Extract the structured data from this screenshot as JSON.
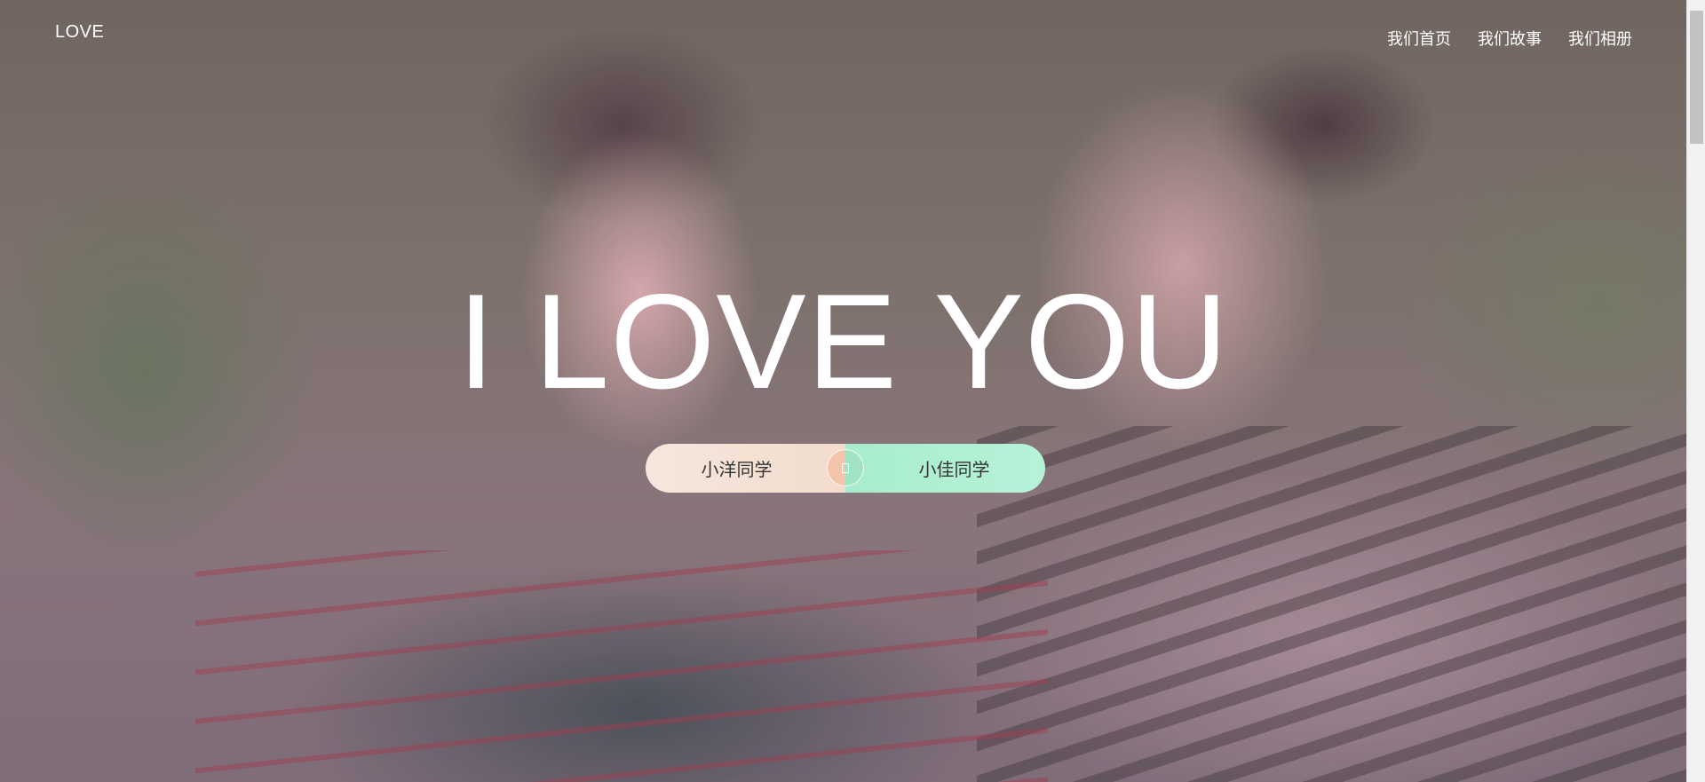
{
  "header": {
    "logo": "LOVE",
    "nav": [
      "我们首页",
      "我们故事",
      "我们相册"
    ]
  },
  "hero": {
    "headline": "I LOVE YOU",
    "left_name": "小洋同学",
    "right_name": "小佳同学",
    "center_icon": "heart-icon"
  },
  "colors": {
    "left_pill": "#f3e2d6",
    "right_pill": "#aeefd2",
    "text_on_photo": "#ffffff"
  }
}
